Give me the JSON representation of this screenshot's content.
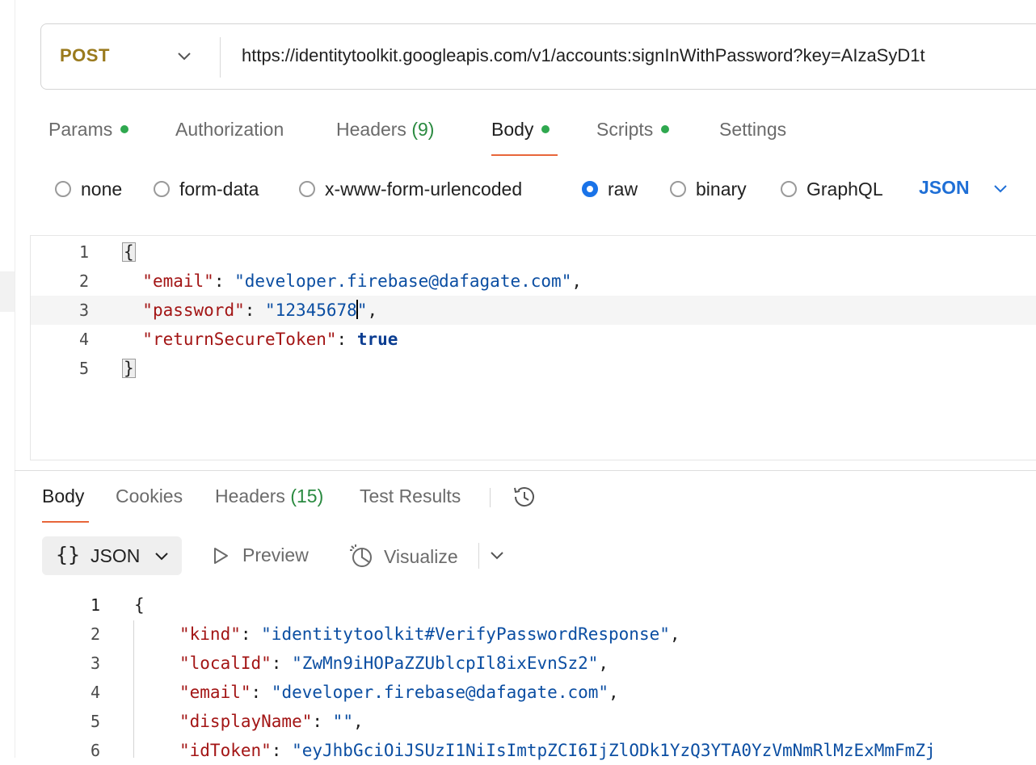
{
  "request": {
    "method": "POST",
    "url": "https://identitytoolkit.googleapis.com/v1/accounts:signInWithPassword?key=AIzaSyD1t"
  },
  "request_tabs": [
    {
      "label": "Params",
      "dot": true
    },
    {
      "label": "Authorization",
      "dot": false
    },
    {
      "label": "Headers",
      "count": "(9)",
      "dot": false
    },
    {
      "label": "Body",
      "dot": true,
      "active": true
    },
    {
      "label": "Scripts",
      "dot": true
    },
    {
      "label": "Settings",
      "dot": false
    }
  ],
  "body_modes": {
    "options": [
      "none",
      "form-data",
      "x-www-form-urlencoded",
      "raw",
      "binary",
      "GraphQL"
    ],
    "selected": "raw",
    "format": "JSON"
  },
  "request_body": {
    "line_numbers": [
      "1",
      "2",
      "3",
      "4",
      "5"
    ],
    "open_brace": "{",
    "close_brace": "}",
    "fields": [
      {
        "key": "\"email\"",
        "value": "\"developer.firebase@dafagate.com\""
      },
      {
        "key": "\"password\"",
        "value_before_caret": "\"12345678",
        "value_after_caret": "\""
      },
      {
        "key": "\"returnSecureToken\"",
        "value": "true"
      }
    ]
  },
  "response_tabs": [
    {
      "label": "Body",
      "active": true
    },
    {
      "label": "Cookies"
    },
    {
      "label": "Headers",
      "count": "(15)"
    },
    {
      "label": "Test Results"
    }
  ],
  "response_toolbar": {
    "format_braces": "{}",
    "format_label": "JSON",
    "preview_label": "Preview",
    "visualize_label": "Visualize"
  },
  "response_body": {
    "line_numbers": [
      "1",
      "2",
      "3",
      "4",
      "5",
      "6"
    ],
    "open_brace": "{",
    "fields": [
      {
        "key": "\"kind\"",
        "value": "\"identitytoolkit#VerifyPasswordResponse\""
      },
      {
        "key": "\"localId\"",
        "value": "\"ZwMn9iHOPaZZUblcpIl8ixEvnSz2\""
      },
      {
        "key": "\"email\"",
        "value": "\"developer.firebase@dafagate.com\""
      },
      {
        "key": "\"displayName\"",
        "value": "\"\""
      },
      {
        "key": "\"idToken\"",
        "value": "\"eyJhbGciOiJSUzI1NiIsImtpZCI6IjZlODk1YzQ3YTA0YzVmNmRlMzExMmFmZj"
      }
    ]
  },
  "colors": {
    "method": "#9a7a1d",
    "active_tab_underline": "#e8663a",
    "status_dot": "#2fa84f",
    "radio_selected": "#1a73e8",
    "json_key": "#a31515",
    "json_string": "#0b4ea2"
  }
}
